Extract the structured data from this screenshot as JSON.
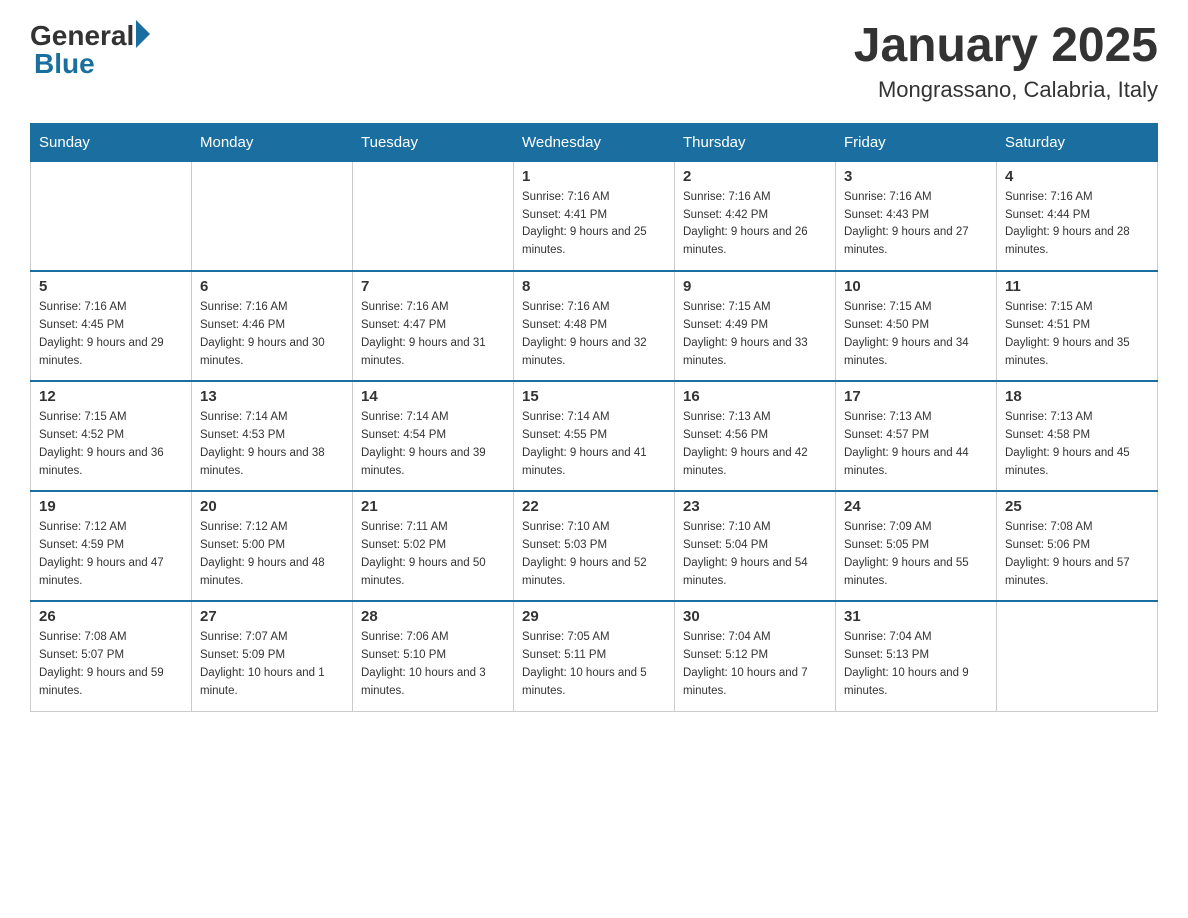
{
  "logo": {
    "general": "General",
    "blue": "Blue",
    "arrow_color": "#1a6fa0"
  },
  "title": "January 2025",
  "subtitle": "Mongrassano, Calabria, Italy",
  "days_of_week": [
    "Sunday",
    "Monday",
    "Tuesday",
    "Wednesday",
    "Thursday",
    "Friday",
    "Saturday"
  ],
  "weeks": [
    [
      {
        "day": "",
        "sunrise": "",
        "sunset": "",
        "daylight": ""
      },
      {
        "day": "",
        "sunrise": "",
        "sunset": "",
        "daylight": ""
      },
      {
        "day": "",
        "sunrise": "",
        "sunset": "",
        "daylight": ""
      },
      {
        "day": "1",
        "sunrise": "Sunrise: 7:16 AM",
        "sunset": "Sunset: 4:41 PM",
        "daylight": "Daylight: 9 hours and 25 minutes."
      },
      {
        "day": "2",
        "sunrise": "Sunrise: 7:16 AM",
        "sunset": "Sunset: 4:42 PM",
        "daylight": "Daylight: 9 hours and 26 minutes."
      },
      {
        "day": "3",
        "sunrise": "Sunrise: 7:16 AM",
        "sunset": "Sunset: 4:43 PM",
        "daylight": "Daylight: 9 hours and 27 minutes."
      },
      {
        "day": "4",
        "sunrise": "Sunrise: 7:16 AM",
        "sunset": "Sunset: 4:44 PM",
        "daylight": "Daylight: 9 hours and 28 minutes."
      }
    ],
    [
      {
        "day": "5",
        "sunrise": "Sunrise: 7:16 AM",
        "sunset": "Sunset: 4:45 PM",
        "daylight": "Daylight: 9 hours and 29 minutes."
      },
      {
        "day": "6",
        "sunrise": "Sunrise: 7:16 AM",
        "sunset": "Sunset: 4:46 PM",
        "daylight": "Daylight: 9 hours and 30 minutes."
      },
      {
        "day": "7",
        "sunrise": "Sunrise: 7:16 AM",
        "sunset": "Sunset: 4:47 PM",
        "daylight": "Daylight: 9 hours and 31 minutes."
      },
      {
        "day": "8",
        "sunrise": "Sunrise: 7:16 AM",
        "sunset": "Sunset: 4:48 PM",
        "daylight": "Daylight: 9 hours and 32 minutes."
      },
      {
        "day": "9",
        "sunrise": "Sunrise: 7:15 AM",
        "sunset": "Sunset: 4:49 PM",
        "daylight": "Daylight: 9 hours and 33 minutes."
      },
      {
        "day": "10",
        "sunrise": "Sunrise: 7:15 AM",
        "sunset": "Sunset: 4:50 PM",
        "daylight": "Daylight: 9 hours and 34 minutes."
      },
      {
        "day": "11",
        "sunrise": "Sunrise: 7:15 AM",
        "sunset": "Sunset: 4:51 PM",
        "daylight": "Daylight: 9 hours and 35 minutes."
      }
    ],
    [
      {
        "day": "12",
        "sunrise": "Sunrise: 7:15 AM",
        "sunset": "Sunset: 4:52 PM",
        "daylight": "Daylight: 9 hours and 36 minutes."
      },
      {
        "day": "13",
        "sunrise": "Sunrise: 7:14 AM",
        "sunset": "Sunset: 4:53 PM",
        "daylight": "Daylight: 9 hours and 38 minutes."
      },
      {
        "day": "14",
        "sunrise": "Sunrise: 7:14 AM",
        "sunset": "Sunset: 4:54 PM",
        "daylight": "Daylight: 9 hours and 39 minutes."
      },
      {
        "day": "15",
        "sunrise": "Sunrise: 7:14 AM",
        "sunset": "Sunset: 4:55 PM",
        "daylight": "Daylight: 9 hours and 41 minutes."
      },
      {
        "day": "16",
        "sunrise": "Sunrise: 7:13 AM",
        "sunset": "Sunset: 4:56 PM",
        "daylight": "Daylight: 9 hours and 42 minutes."
      },
      {
        "day": "17",
        "sunrise": "Sunrise: 7:13 AM",
        "sunset": "Sunset: 4:57 PM",
        "daylight": "Daylight: 9 hours and 44 minutes."
      },
      {
        "day": "18",
        "sunrise": "Sunrise: 7:13 AM",
        "sunset": "Sunset: 4:58 PM",
        "daylight": "Daylight: 9 hours and 45 minutes."
      }
    ],
    [
      {
        "day": "19",
        "sunrise": "Sunrise: 7:12 AM",
        "sunset": "Sunset: 4:59 PM",
        "daylight": "Daylight: 9 hours and 47 minutes."
      },
      {
        "day": "20",
        "sunrise": "Sunrise: 7:12 AM",
        "sunset": "Sunset: 5:00 PM",
        "daylight": "Daylight: 9 hours and 48 minutes."
      },
      {
        "day": "21",
        "sunrise": "Sunrise: 7:11 AM",
        "sunset": "Sunset: 5:02 PM",
        "daylight": "Daylight: 9 hours and 50 minutes."
      },
      {
        "day": "22",
        "sunrise": "Sunrise: 7:10 AM",
        "sunset": "Sunset: 5:03 PM",
        "daylight": "Daylight: 9 hours and 52 minutes."
      },
      {
        "day": "23",
        "sunrise": "Sunrise: 7:10 AM",
        "sunset": "Sunset: 5:04 PM",
        "daylight": "Daylight: 9 hours and 54 minutes."
      },
      {
        "day": "24",
        "sunrise": "Sunrise: 7:09 AM",
        "sunset": "Sunset: 5:05 PM",
        "daylight": "Daylight: 9 hours and 55 minutes."
      },
      {
        "day": "25",
        "sunrise": "Sunrise: 7:08 AM",
        "sunset": "Sunset: 5:06 PM",
        "daylight": "Daylight: 9 hours and 57 minutes."
      }
    ],
    [
      {
        "day": "26",
        "sunrise": "Sunrise: 7:08 AM",
        "sunset": "Sunset: 5:07 PM",
        "daylight": "Daylight: 9 hours and 59 minutes."
      },
      {
        "day": "27",
        "sunrise": "Sunrise: 7:07 AM",
        "sunset": "Sunset: 5:09 PM",
        "daylight": "Daylight: 10 hours and 1 minute."
      },
      {
        "day": "28",
        "sunrise": "Sunrise: 7:06 AM",
        "sunset": "Sunset: 5:10 PM",
        "daylight": "Daylight: 10 hours and 3 minutes."
      },
      {
        "day": "29",
        "sunrise": "Sunrise: 7:05 AM",
        "sunset": "Sunset: 5:11 PM",
        "daylight": "Daylight: 10 hours and 5 minutes."
      },
      {
        "day": "30",
        "sunrise": "Sunrise: 7:04 AM",
        "sunset": "Sunset: 5:12 PM",
        "daylight": "Daylight: 10 hours and 7 minutes."
      },
      {
        "day": "31",
        "sunrise": "Sunrise: 7:04 AM",
        "sunset": "Sunset: 5:13 PM",
        "daylight": "Daylight: 10 hours and 9 minutes."
      },
      {
        "day": "",
        "sunrise": "",
        "sunset": "",
        "daylight": ""
      }
    ]
  ]
}
